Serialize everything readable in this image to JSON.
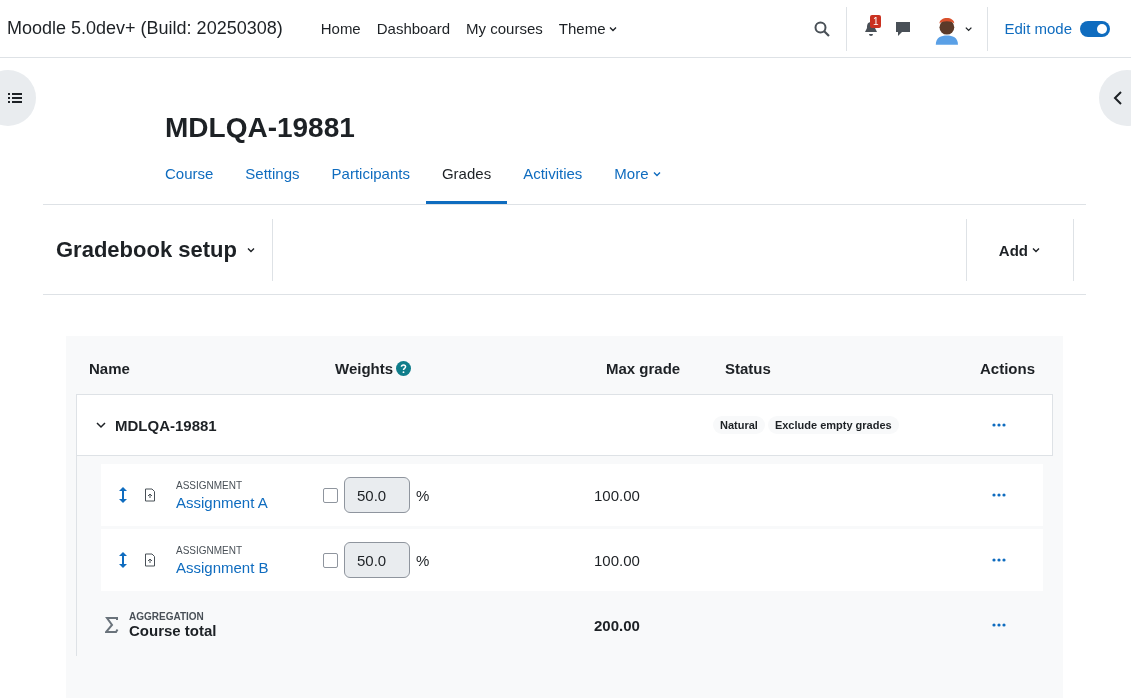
{
  "site_title": "Moodle 5.0dev+ (Build: 20250308)",
  "nav": [
    {
      "label": "Home",
      "dropdown": false
    },
    {
      "label": "Dashboard",
      "dropdown": false
    },
    {
      "label": "My courses",
      "dropdown": false
    },
    {
      "label": "Theme",
      "dropdown": true
    }
  ],
  "notifications": {
    "count": "1"
  },
  "edit_mode": {
    "label": "Edit mode",
    "on": true
  },
  "course_title": "MDLQA-19881",
  "tabs": [
    {
      "label": "Course",
      "selected": false,
      "dropdown": false
    },
    {
      "label": "Settings",
      "selected": false,
      "dropdown": false
    },
    {
      "label": "Participants",
      "selected": false,
      "dropdown": false
    },
    {
      "label": "Grades",
      "selected": true,
      "dropdown": false
    },
    {
      "label": "Activities",
      "selected": false,
      "dropdown": false
    },
    {
      "label": "More",
      "selected": false,
      "dropdown": true
    }
  ],
  "page_heading": "Gradebook setup",
  "add_button": "Add",
  "table": {
    "columns": [
      {
        "label": "Name",
        "help": false
      },
      {
        "label": "Weights",
        "help": true
      },
      {
        "label": "Max grade",
        "help": false
      },
      {
        "label": "Status",
        "help": false
      },
      {
        "label": "Actions",
        "help": false
      }
    ],
    "category": {
      "name": "MDLQA-19881",
      "expanded": true,
      "status_badges": [
        "Natural",
        "Exclude empty grades"
      ]
    },
    "items": [
      {
        "type_label": "ASSIGNMENT",
        "name": "Assignment A",
        "weight_override": false,
        "weight": "50.0",
        "unit": "%",
        "max_grade": "100.00"
      },
      {
        "type_label": "ASSIGNMENT",
        "name": "Assignment B",
        "weight_override": false,
        "weight": "50.0",
        "unit": "%",
        "max_grade": "100.00"
      }
    ],
    "total": {
      "type_label": "AGGREGATION",
      "name": "Course total",
      "max_grade": "200.00"
    }
  }
}
